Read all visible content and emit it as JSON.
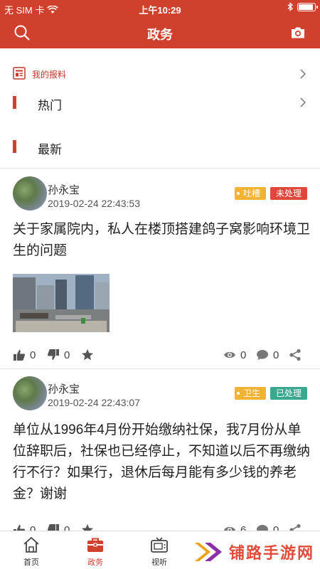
{
  "status_bar": {
    "carrier": "无 SIM 卡",
    "time": "上午10:29"
  },
  "nav": {
    "title": "政务",
    "search_icon": "search-icon",
    "camera_icon": "camera-icon"
  },
  "report": {
    "label": "我的报料"
  },
  "sections": {
    "hot": "热门",
    "latest": "最新"
  },
  "posts": [
    {
      "author": "孙永宝",
      "time": "2019-02-24 22:43:53",
      "tag_category": "吐槽",
      "tag_status": "未处理",
      "title": "关于家属院内，私人在楼顶搭建鸽子窝影响环境卫生的问题",
      "likes": "0",
      "dislikes": "0",
      "views": "0",
      "comments": "0"
    },
    {
      "author": "孙永宝",
      "time": "2019-02-24 22:43:07",
      "tag_category": "卫生",
      "tag_status": "已处理",
      "title": "单位从1996年4月份开始缴纳社保，我7月份从单位辞职后，社保也已经停止，不知道以后不再缴纳行不行？如果行，退休后每月能有多少钱的养老金？谢谢",
      "likes": "0",
      "dislikes": "0",
      "views": "6",
      "comments": "0"
    }
  ],
  "tabs": [
    {
      "label": "首页",
      "icon": "home-icon"
    },
    {
      "label": "政务",
      "icon": "briefcase-icon"
    },
    {
      "label": "视听",
      "icon": "tv-icon"
    }
  ],
  "watermark": {
    "text": "铺路手游网"
  },
  "colors": {
    "brand": "#d0412d",
    "tag_category": "#f2b233",
    "tag_todo": "#e0463b",
    "tag_done": "#3aa88f"
  }
}
